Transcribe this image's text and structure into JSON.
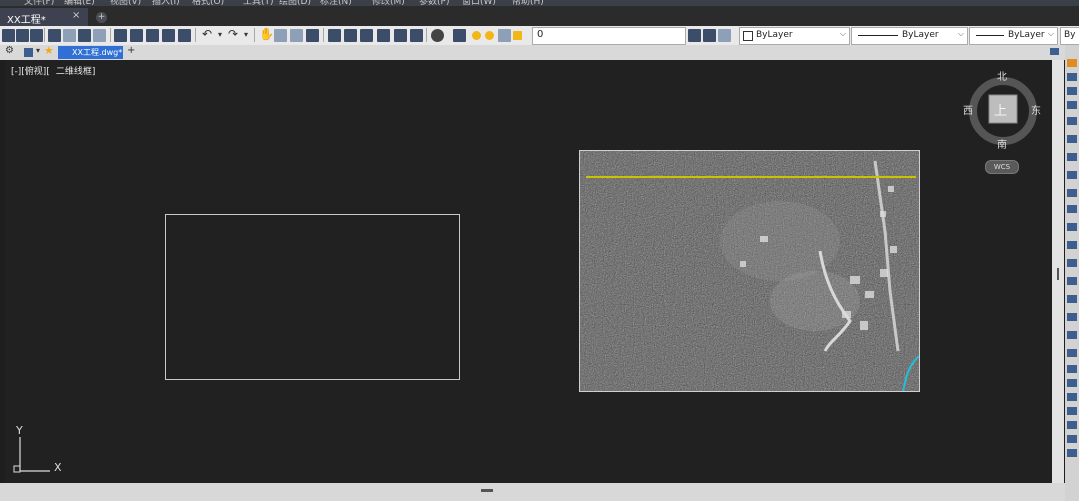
{
  "menubar": {
    "items": [
      "文件(F)",
      "编辑(E)",
      "视图(V)",
      "插入(I)",
      "格式(O)",
      "工具(T)",
      "绘图(D)",
      "标注(N)",
      "修改(M)",
      "参数(P)",
      "窗口(W)",
      "帮助(H)"
    ]
  },
  "doc_tab": {
    "title": "XX工程*",
    "close": "×",
    "add": "+"
  },
  "toolbar": {
    "layer_value": "0",
    "color_value": "ByLayer",
    "linetype_value": "ByLayer",
    "lineweight_value": "ByLayer",
    "plotstyle_value": "By"
  },
  "file_tab": {
    "title": "XX工程.dwg*",
    "add": "+"
  },
  "viewport": {
    "bracket_label": "[-][俯视][",
    "style_label": "二维线框]"
  },
  "viewcube": {
    "north": "北",
    "south": "南",
    "east": "东",
    "west": "西",
    "face": "上",
    "wcs": "WCS"
  },
  "ucs": {
    "x": "X",
    "y": "Y"
  },
  "colors": {
    "canvas": "#212121",
    "accent_tab": "#2f6fd6",
    "yellow_line": "#c8c400",
    "cyan_line": "#20c0d8"
  }
}
